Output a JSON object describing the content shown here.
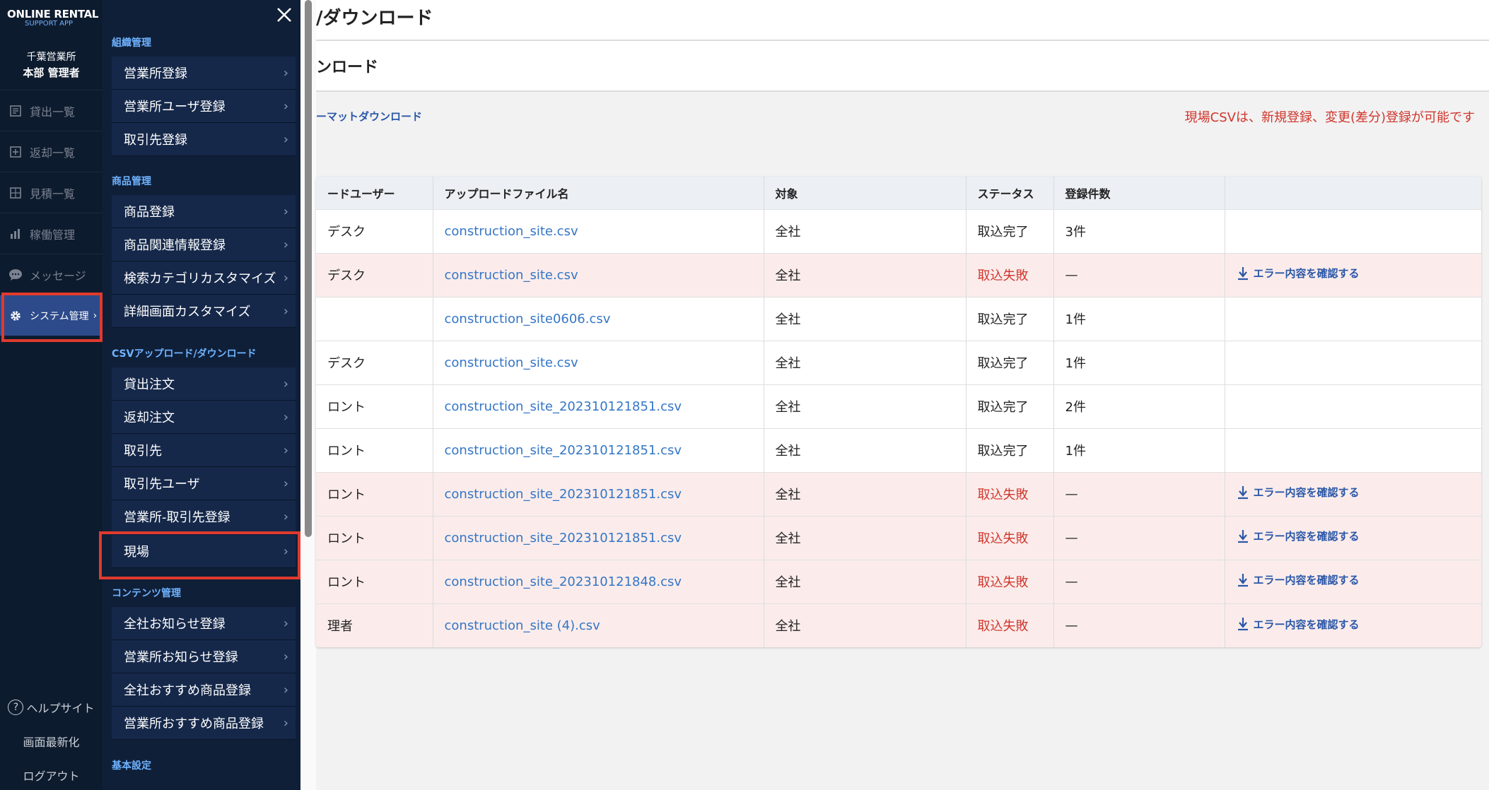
{
  "brand": {
    "line1": "ONLINE RENTAL",
    "line2": "SUPPORT APP"
  },
  "user": {
    "office": "千葉営業所",
    "name": "本部 管理者"
  },
  "rail": {
    "items": [
      {
        "label": "貸出一覧",
        "icon": "rental-list-icon"
      },
      {
        "label": "返却一覧",
        "icon": "return-list-icon"
      },
      {
        "label": "見積一覧",
        "icon": "estimate-list-icon"
      },
      {
        "label": "稼働管理",
        "icon": "operation-chart-icon"
      },
      {
        "label": "メッセージ",
        "icon": "message-icon"
      },
      {
        "label": "システム管理",
        "icon": "gear-icon",
        "active": true
      }
    ],
    "help": "ヘルプサイト",
    "refresh": "画面最新化",
    "logout": "ログアウト"
  },
  "menu": {
    "sections": [
      {
        "title": "組織管理",
        "items": [
          "営業所登録",
          "営業所ユーザ登録",
          "取引先登録"
        ]
      },
      {
        "title": "商品管理",
        "items": [
          "商品登録",
          "商品関連情報登録",
          "検索カテゴリカスタマイズ",
          "詳細画面カスタマイズ"
        ]
      },
      {
        "title": "CSVアップロード/ダウンロード",
        "items": [
          "貸出注文",
          "返却注文",
          "取引先",
          "取引先ユーザ",
          "営業所-取引先登録",
          "現場"
        ]
      },
      {
        "title": "コンテンツ管理",
        "items": [
          "全社お知らせ登録",
          "営業所お知らせ登録",
          "全社おすすめ商品登録",
          "営業所おすすめ商品登録"
        ]
      },
      {
        "title": "基本設定",
        "items": []
      }
    ]
  },
  "main": {
    "page_title": "/ダウンロード",
    "sub_title": "ンロード",
    "format_link": "ーマットダウンロード",
    "note": "現場CSVは、新規登録、変更(差分)登録が可能です",
    "table": {
      "headers": [
        "ードユーザー",
        "アップロードファイル名",
        "対象",
        "ステータス",
        "登録件数",
        ""
      ],
      "rows": [
        {
          "user": "デスク",
          "file": "construction_site.csv",
          "target": "全社",
          "status": "取込完了",
          "count": "3件",
          "action": "",
          "fail": false
        },
        {
          "user": "デスク",
          "file": "construction_site.csv",
          "target": "全社",
          "status": "取込失敗",
          "count": "—",
          "action": "エラー内容を確認する",
          "fail": true
        },
        {
          "user": "",
          "file": "construction_site0606.csv",
          "target": "全社",
          "status": "取込完了",
          "count": "1件",
          "action": "",
          "fail": false
        },
        {
          "user": "デスク",
          "file": "construction_site.csv",
          "target": "全社",
          "status": "取込完了",
          "count": "1件",
          "action": "",
          "fail": false
        },
        {
          "user": "ロント",
          "file": "construction_site_202310121851.csv",
          "target": "全社",
          "status": "取込完了",
          "count": "2件",
          "action": "",
          "fail": false
        },
        {
          "user": "ロント",
          "file": "construction_site_202310121851.csv",
          "target": "全社",
          "status": "取込完了",
          "count": "1件",
          "action": "",
          "fail": false
        },
        {
          "user": "ロント",
          "file": "construction_site_202310121851.csv",
          "target": "全社",
          "status": "取込失敗",
          "count": "—",
          "action": "エラー内容を確認する",
          "fail": true
        },
        {
          "user": "ロント",
          "file": "construction_site_202310121851.csv",
          "target": "全社",
          "status": "取込失敗",
          "count": "—",
          "action": "エラー内容を確認する",
          "fail": true
        },
        {
          "user": "ロント",
          "file": "construction_site_202310121848.csv",
          "target": "全社",
          "status": "取込失敗",
          "count": "—",
          "action": "エラー内容を確認する",
          "fail": true
        },
        {
          "user": "理者",
          "file": "construction_site (4).csv",
          "target": "全社",
          "status": "取込失敗",
          "count": "—",
          "action": "エラー内容を確認する",
          "fail": true
        }
      ]
    }
  },
  "colors": {
    "rail_bg": "#0d1b2e",
    "menu_bg": "#0f1f38",
    "accent": "#6fb3ff",
    "active": "#2d4a8a",
    "error": "#d0362c",
    "link": "#3476c5",
    "highlight": "#e03a2e"
  }
}
